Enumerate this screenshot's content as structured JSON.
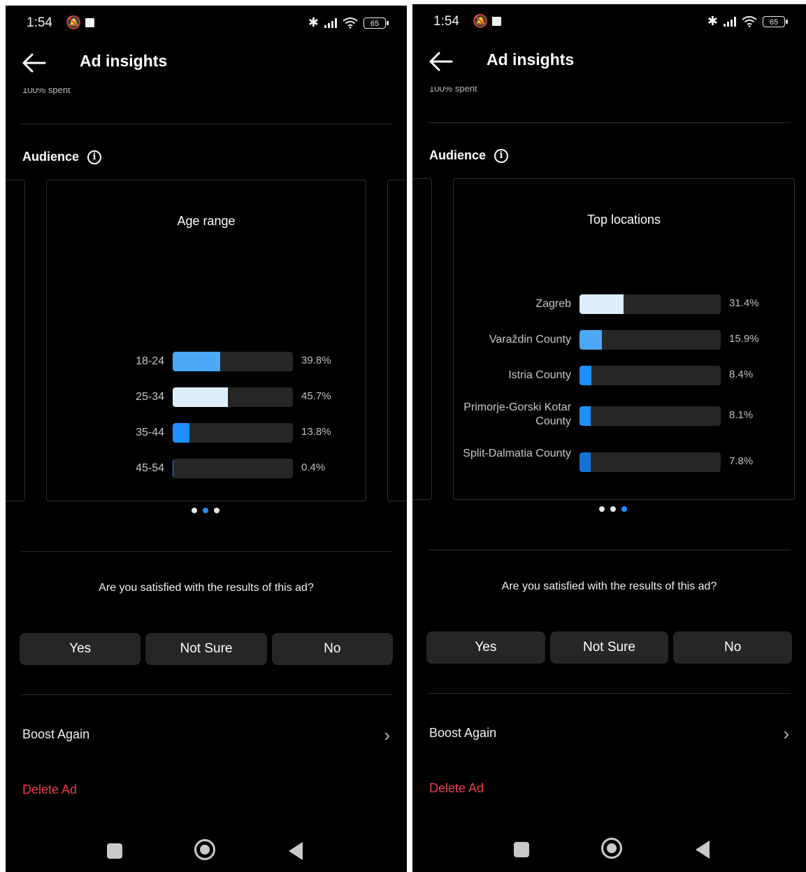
{
  "screens": [
    {
      "status": {
        "time": "1:54",
        "battery": "65"
      },
      "header": {
        "title": "Ad insights"
      },
      "spent_text": "100% spent",
      "audience_label": "Audience",
      "card": {
        "title": "Age range",
        "rows": [
          {
            "label": "18-24",
            "pct": "39.8%",
            "value": 39.8,
            "color": "#4aa8f5"
          },
          {
            "label": "25-34",
            "pct": "45.7%",
            "value": 45.7,
            "color": "#ddeefb"
          },
          {
            "label": "35-44",
            "pct": "13.8%",
            "value": 13.8,
            "color": "#1e90ff"
          },
          {
            "label": "45-54",
            "pct": "0.4%",
            "value": 0.4,
            "color": "#1e90ff"
          }
        ]
      },
      "pager_active": 1,
      "question": "Are you satisfied with the results of this ad?",
      "buttons": {
        "yes": "Yes",
        "not_sure": "Not Sure",
        "no": "No"
      },
      "boost_again": "Boost Again",
      "delete_ad": "Delete Ad"
    },
    {
      "status": {
        "time": "1:54",
        "battery": "65"
      },
      "header": {
        "title": "Ad insights"
      },
      "spent_text": "100% spent",
      "audience_label": "Audience",
      "card": {
        "title": "Top locations",
        "rows": [
          {
            "label": "Zagreb",
            "pct": "31.4%",
            "value": 31.4,
            "color": "#ddeefb"
          },
          {
            "label": "Varaždin County",
            "pct": "15.9%",
            "value": 15.9,
            "color": "#4aa8f5"
          },
          {
            "label": "Istria County",
            "pct": "8.4%",
            "value": 8.4,
            "color": "#1e90ff"
          },
          {
            "label": "Primorje-Gorski Kotar County",
            "pct": "8.1%",
            "value": 8.1,
            "color": "#1e90ff"
          },
          {
            "label": "Split-Dalmatia County",
            "pct": "7.8%",
            "value": 7.8,
            "color": "#1573d8"
          }
        ]
      },
      "pager_active": 2,
      "question": "Are you satisfied with the results of this ad?",
      "buttons": {
        "yes": "Yes",
        "not_sure": "Not Sure",
        "no": "No"
      },
      "boost_again": "Boost Again",
      "delete_ad": "Delete Ad"
    }
  ]
}
